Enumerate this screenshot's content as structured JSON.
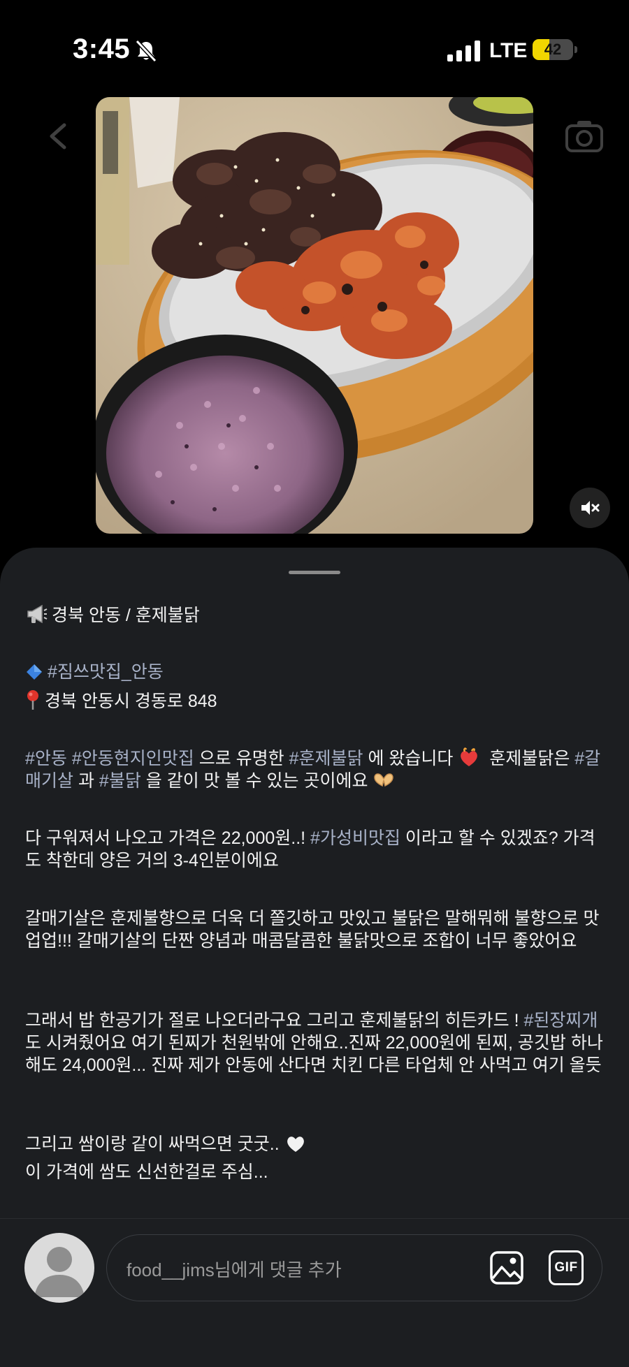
{
  "status_bar": {
    "time": "3:45",
    "network": "LTE",
    "battery_level": "42",
    "battery_fraction": 0.42
  },
  "photo": {
    "icons": [
      "back-arrow-icon",
      "camera-icon",
      "mute-icon"
    ]
  },
  "post": {
    "location_header": "경북 안동 / 훈제불닭",
    "hashtag_line": "#짐쓰맛집_안동",
    "address": "경북 안동시 경동로 848",
    "para1_tag1": "#안동",
    "para1_tag2": "#안동현지인맛집",
    "para1_text1": " 으로 유명한 ",
    "para1_tag3": "#훈제불닭",
    "para1_text2": " 에 왔습니다",
    "para1_text3": " 훈제불닭은 ",
    "para1_tag4": "#갈매기살",
    "para1_text4": " 과 ",
    "para1_tag5": "#불닭",
    "para1_text5": " 을 같이 맛 볼 수 있는 곳이에요",
    "para2_text1": "다 구워져서 나오고 가격은 22,000원..! ",
    "para2_tag": "#가성비맛집",
    "para2_text2": " 이라고 할 수 있겠죠? 가격도 착한데 양은 거의 3-4인분이에요",
    "para3": "갈매기살은 훈제불향으로 더욱 더 쫄깃하고 맛있고 불닭은 말해뭐해 불향으로 맛 업업!!! 갈매기살의 단짠 양념과 매콤달콤한 불닭맛으로 조합이 너무 좋았어요",
    "para4_text1": "그래서 밥 한공기가 절로 나오더라구요 그리고 훈제불닭의 히든카드 ! ",
    "para4_tag": "#된장찌개",
    "para4_text2": " 도 시켜줬어요 여기 된찌가 천원밖에 안해요..진짜 22,000원에 된찌, 공깃밥 하나해도 24,000원... 진짜 제가 안동에 산다면 치킨 다른 타업체 안 사먹고 여기 올듯",
    "para5_line1": "그리고 쌈이랑 같이 싸먹으면 굿굿..",
    "para5_line2": "이 가격에 쌈도 신선한걸로 주심..."
  },
  "comment_bar": {
    "placeholder": "food__jims님에게 댓글 추가",
    "gif_label": "GIF"
  },
  "colors": {
    "background": "#000000",
    "sheet": "#1c1e21",
    "hashtag": "#a8b2c8",
    "battery": "#f1d600"
  }
}
